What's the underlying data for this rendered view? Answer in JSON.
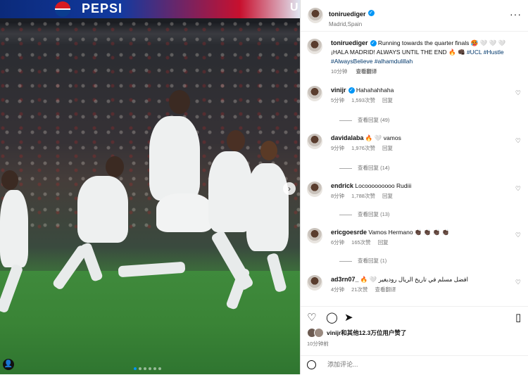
{
  "post": {
    "banner_text": "PEPSI",
    "banner_edge": "U"
  },
  "author": {
    "username": "toniruediger",
    "location": "Madrid,Spain"
  },
  "caption": {
    "username": "toniruediger",
    "line1": "Running towards the quarter finals 🥵 🤍 🤍 🤍",
    "line2": "¡HALA MADRID! ALWAYS UNTIL THE END 🔥 👊🏿",
    "tag_ucl": "#UCL",
    "tag_hustle": "#Hustle",
    "tag_believe": "#AlwaysBelieve",
    "tag_alham": "#alhamdulillah",
    "time": "10分钟",
    "translate": "查看翻译"
  },
  "comments": [
    {
      "username": "vinijr",
      "text": "Hahahahhaha",
      "time": "5分钟",
      "likes": "1,593次赞",
      "reply": "回复",
      "replies": "查看回复 (49)"
    },
    {
      "username": "davidalaba",
      "text": "🔥 🤍 vamos",
      "time": "9分钟",
      "likes": "1,976次赞",
      "reply": "回复",
      "replies": "查看回复 (14)"
    },
    {
      "username": "endrick",
      "text": "Locooooooooo Rudiii",
      "time": "8分钟",
      "likes": "1,788次赞",
      "reply": "回复",
      "replies": "查看回复 (13)"
    },
    {
      "username": "ericgoesrde",
      "text": "Vamos Hermano 👏🏿 👏🏿 👏🏿 👏🏿",
      "time": "6分钟",
      "likes": "165次赞",
      "reply": "回复",
      "replies": "查看回复 (1)"
    },
    {
      "username": "ad3rn07_",
      "text": "🔥 🤍 افضل مسلم في تاريخ الريال روديغير",
      "time": "4分钟",
      "likes": "21次赞",
      "reply": "回复",
      "translate": "查看翻译"
    }
  ],
  "likes_line": "vinijr和其他12.3万位用户赞了",
  "posted_ago": "10分钟前",
  "comment_input": {
    "placeholder": "添加评论..."
  },
  "colors": {
    "accent": "#0095f6",
    "secondary_text": "#737373"
  },
  "icons": [
    "heart-icon",
    "comment-icon",
    "share-icon",
    "bookmark-icon",
    "more-icon",
    "verified-icon",
    "emoji-icon",
    "next-icon"
  ]
}
